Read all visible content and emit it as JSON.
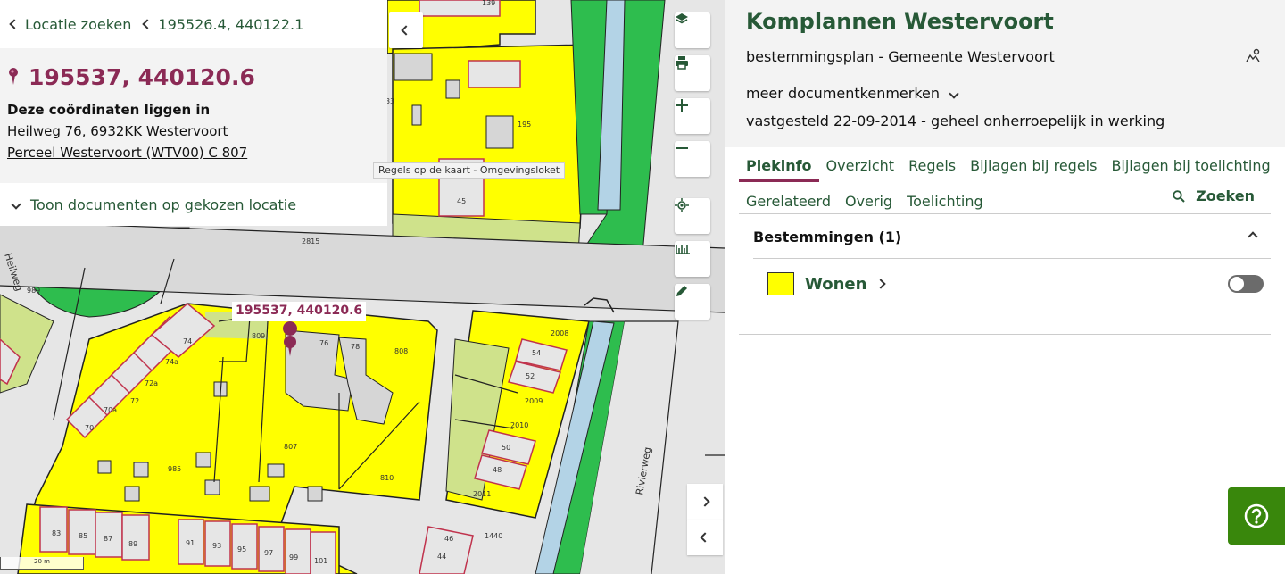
{
  "breadcrumbs": [
    {
      "label": "Locatie zoeken"
    },
    {
      "label": "195526.4, 440122.1"
    }
  ],
  "location": {
    "coordinates": "195537, 440120.6",
    "intro": "Deze coördinaten liggen in",
    "address": "Heilweg 76, 6932KK Westervoort",
    "parcel": "Perceel Westervoort (WTV00) C 807",
    "show_docs": "Toon documenten op gekozen locatie"
  },
  "map": {
    "tooltip": "Regels op de kaart - Omgevingsloket",
    "marker_label": "195537, 440120.6",
    "scale": "20 m",
    "street_heilweg": "Heilweg",
    "street_rivierweg": "Rivierweg",
    "lots": [
      "139",
      "195",
      "45",
      "2815",
      "989",
      "809",
      "76",
      "78",
      "808",
      "74",
      "74a",
      "72a",
      "72",
      "70a",
      "70",
      "807",
      "985",
      "810",
      "2008",
      "54",
      "52",
      "2009",
      "2010",
      "50",
      "48",
      "2011",
      "1440",
      "46",
      "44",
      "83",
      "85",
      "87",
      "89",
      "91",
      "93",
      "95",
      "97",
      "99",
      "101",
      "33"
    ],
    "tools": [
      "layers-icon",
      "print-icon",
      "zoom-in-icon",
      "zoom-out-icon",
      "locate-icon",
      "measure-icon",
      "draw-icon"
    ]
  },
  "plan": {
    "title": "Komplannen Westervoort",
    "subtitle": "bestemmingsplan - Gemeente Westervoort",
    "meer": "meer documentkenmerken",
    "status": "vastgesteld 22-09-2014 - geheel onherroepelijk in werking"
  },
  "tabs": [
    "Plekinfo",
    "Overzicht",
    "Regels",
    "Bijlagen bij regels",
    "Bijlagen bij toelichting"
  ],
  "tabs2": [
    "Gerelateerd",
    "Overig",
    "Toelichting"
  ],
  "search_label": "Zoeken",
  "bestemmingen": {
    "title": "Bestemmingen (1)",
    "items": [
      {
        "label": "Wonen",
        "color": "#ffff00"
      }
    ]
  },
  "colors": {
    "green": "#275937",
    "accent": "#8b2a55",
    "help": "#39870c"
  }
}
